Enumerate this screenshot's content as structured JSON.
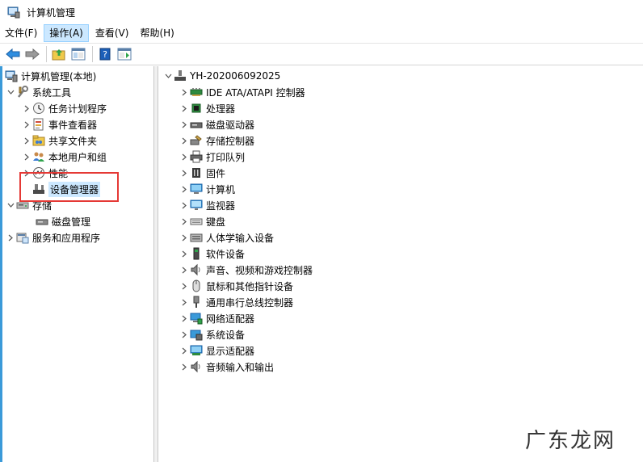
{
  "window": {
    "title": "计算机管理"
  },
  "menu": [
    {
      "label": "文件(F)",
      "active": false
    },
    {
      "label": "操作(A)",
      "active": true
    },
    {
      "label": "查看(V)",
      "active": false
    },
    {
      "label": "帮助(H)",
      "active": false
    }
  ],
  "tree": {
    "root": "计算机管理(本地)",
    "system_tools": "系统工具",
    "task_scheduler": "任务计划程序",
    "event_viewer": "事件查看器",
    "shared_folders": "共享文件夹",
    "local_users": "本地用户和组",
    "performance": "性能",
    "device_manager": "设备管理器",
    "storage": "存储",
    "disk_management": "磁盘管理",
    "services_apps": "服务和应用程序"
  },
  "devices": {
    "computer_name": "YH-202006092025",
    "categories": [
      {
        "label": "IDE ATA/ATAPI 控制器",
        "icon": "ide-controller-icon"
      },
      {
        "label": "处理器",
        "icon": "processor-icon"
      },
      {
        "label": "磁盘驱动器",
        "icon": "disk-drive-icon"
      },
      {
        "label": "存储控制器",
        "icon": "storage-controller-icon"
      },
      {
        "label": "打印队列",
        "icon": "printer-icon"
      },
      {
        "label": "固件",
        "icon": "firmware-icon"
      },
      {
        "label": "计算机",
        "icon": "computer-icon"
      },
      {
        "label": "监视器",
        "icon": "monitor-icon"
      },
      {
        "label": "键盘",
        "icon": "keyboard-icon"
      },
      {
        "label": "人体学输入设备",
        "icon": "hid-icon"
      },
      {
        "label": "软件设备",
        "icon": "software-device-icon"
      },
      {
        "label": "声音、视频和游戏控制器",
        "icon": "sound-icon"
      },
      {
        "label": "鼠标和其他指针设备",
        "icon": "mouse-icon"
      },
      {
        "label": "通用串行总线控制器",
        "icon": "usb-icon"
      },
      {
        "label": "网络适配器",
        "icon": "network-adapter-icon"
      },
      {
        "label": "系统设备",
        "icon": "system-device-icon"
      },
      {
        "label": "显示适配器",
        "icon": "display-adapter-icon"
      },
      {
        "label": "音频输入和输出",
        "icon": "audio-io-icon"
      }
    ]
  },
  "watermark": "广东龙网",
  "colors": {
    "accent": "#3b9ad9",
    "selection": "#cce8ff",
    "highlight_box": "#e53935"
  }
}
